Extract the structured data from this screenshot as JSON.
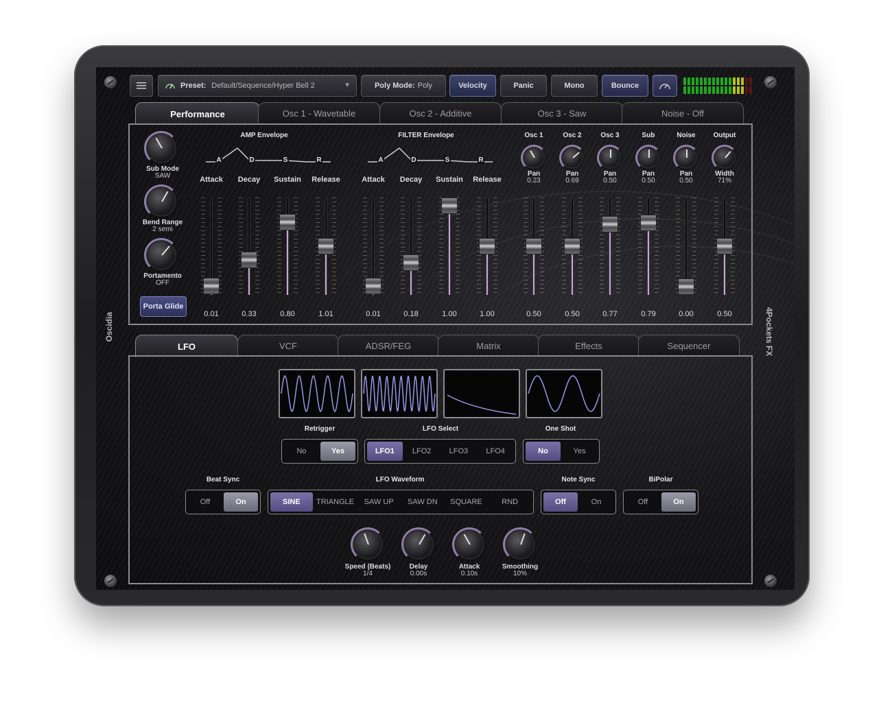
{
  "app": {
    "name_left": "Oscidia",
    "name_right": "4Pockets FX"
  },
  "toolbar": {
    "menu_icon": "menu-icon",
    "preset_label": "Preset:",
    "preset_value": "Default/Sequence/Hyper Bell 2",
    "poly_mode_label": "Poly Mode:",
    "poly_mode_value": "Poly",
    "velocity": "Velocity",
    "panic": "Panic",
    "mono": "Mono",
    "bounce": "Bounce",
    "gauge_icon": "gauge-icon"
  },
  "top_tabs": [
    {
      "label": "Performance",
      "active": true
    },
    {
      "label": "Osc 1 - Wavetable",
      "active": false
    },
    {
      "label": "Osc 2 - Additive",
      "active": false
    },
    {
      "label": "Osc 3 - Saw",
      "active": false
    },
    {
      "label": "Noise - Off",
      "active": false
    }
  ],
  "performance": {
    "left_knobs": [
      {
        "label": "Sub Mode",
        "value": "SAW"
      },
      {
        "label": "Bend Range",
        "value": "2 semi"
      },
      {
        "label": "Portamento",
        "value": "OFF"
      }
    ],
    "porta_glide": "Porta Glide",
    "amp_envelope": {
      "title": "AMP Envelope",
      "stages": [
        "A",
        "D",
        "S",
        "R"
      ],
      "params": [
        {
          "label": "Attack",
          "value": "0.01",
          "level": 0.01
        },
        {
          "label": "Decay",
          "value": "0.33",
          "level": 0.33
        },
        {
          "label": "Sustain",
          "value": "0.80",
          "level": 0.8
        },
        {
          "label": "Release",
          "value": "1.01",
          "level": 0.5
        }
      ]
    },
    "filter_envelope": {
      "title": "FILTER Envelope",
      "stages": [
        "A",
        "D",
        "S",
        "R"
      ],
      "params": [
        {
          "label": "Attack",
          "value": "0.01",
          "level": 0.01
        },
        {
          "label": "Decay",
          "value": "0.18",
          "level": 0.3
        },
        {
          "label": "Sustain",
          "value": "1.00",
          "level": 1.0
        },
        {
          "label": "Release",
          "value": "1.00",
          "level": 0.5
        }
      ]
    },
    "mixer": [
      {
        "label": "Osc 1",
        "knob_label": "Pan",
        "knob_value": "0.23",
        "value": "0.50",
        "level": 0.5
      },
      {
        "label": "Osc 2",
        "knob_label": "Pan",
        "knob_value": "0.69",
        "value": "0.50",
        "level": 0.5
      },
      {
        "label": "Osc 3",
        "knob_label": "Pan",
        "knob_value": "0.50",
        "value": "0.77",
        "level": 0.77
      },
      {
        "label": "Sub",
        "knob_label": "Pan",
        "knob_value": "0.50",
        "value": "0.79",
        "level": 0.79
      },
      {
        "label": "Noise",
        "knob_label": "Pan",
        "knob_value": "0.50",
        "value": "0.00",
        "level": 0.0
      },
      {
        "label": "Output",
        "knob_label": "Width",
        "knob_value": "71%",
        "value": "0.50",
        "level": 0.5
      }
    ]
  },
  "bottom_tabs": [
    {
      "label": "LFO",
      "active": true
    },
    {
      "label": "VCF",
      "active": false
    },
    {
      "label": "ADSR/FEG",
      "active": false
    },
    {
      "label": "Matrix",
      "active": false
    },
    {
      "label": "Effects",
      "active": false
    },
    {
      "label": "Sequencer",
      "active": false
    }
  ],
  "lfo": {
    "retrigger": {
      "label": "Retrigger",
      "options": [
        "No",
        "Yes"
      ],
      "selected": "Yes"
    },
    "lfo_select": {
      "label": "LFO Select",
      "options": [
        "LFO1",
        "LFO2",
        "LFO3",
        "LFO4"
      ],
      "selected": "LFO1"
    },
    "one_shot": {
      "label": "One Shot",
      "options": [
        "No",
        "Yes"
      ],
      "selected": "No"
    },
    "beat_sync": {
      "label": "Beat Sync",
      "options": [
        "Off",
        "On"
      ],
      "selected": "On"
    },
    "waveform": {
      "label": "LFO Waveform",
      "options": [
        "SINE",
        "TRIANGLE",
        "SAW UP",
        "SAW DN",
        "SQUARE",
        "RND"
      ],
      "selected": "SINE"
    },
    "note_sync": {
      "label": "Note Sync",
      "options": [
        "Off",
        "On"
      ],
      "selected": "Off"
    },
    "bipolar": {
      "label": "BiPolar",
      "options": [
        "Off",
        "On"
      ],
      "selected": "On"
    },
    "knobs": [
      {
        "label": "Speed (Beats)",
        "value": "1/4"
      },
      {
        "label": "Delay",
        "value": "0.00s"
      },
      {
        "label": "Attack",
        "value": "0.10s"
      },
      {
        "label": "Smoothing",
        "value": "10%"
      }
    ]
  },
  "colors": {
    "accent": "#6a70a6",
    "fader_fill": "#c9a6d8",
    "wave": "#9a96e8",
    "meter_green": "#1ea81e"
  }
}
